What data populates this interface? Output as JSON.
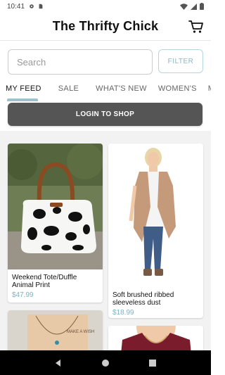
{
  "status_bar": {
    "time": "10:41"
  },
  "header": {
    "title": "The Thrifty Chick"
  },
  "search": {
    "placeholder": "Search",
    "filter_label": "FILTER"
  },
  "tabs": [
    {
      "label": "MY FEED",
      "active": true
    },
    {
      "label": "SALE",
      "active": false
    },
    {
      "label": "WHAT'S NEW",
      "active": false
    },
    {
      "label": "WOMEN'S",
      "active": false
    },
    {
      "label": "MEN",
      "active": false
    }
  ],
  "login_button": {
    "label": "LOGIN TO SHOP"
  },
  "products": [
    {
      "name": "Weekend Tote/Duffle Animal Print",
      "price": "$47.99"
    },
    {
      "name": "Soft brushed ribbed sleeveless dust",
      "price": "$18.99"
    },
    {
      "name": "",
      "price": ""
    },
    {
      "name": "",
      "price": ""
    }
  ],
  "colors": {
    "accent": "#9cc3cd",
    "price": "#7fb2bf",
    "login_bg": "#555555"
  }
}
